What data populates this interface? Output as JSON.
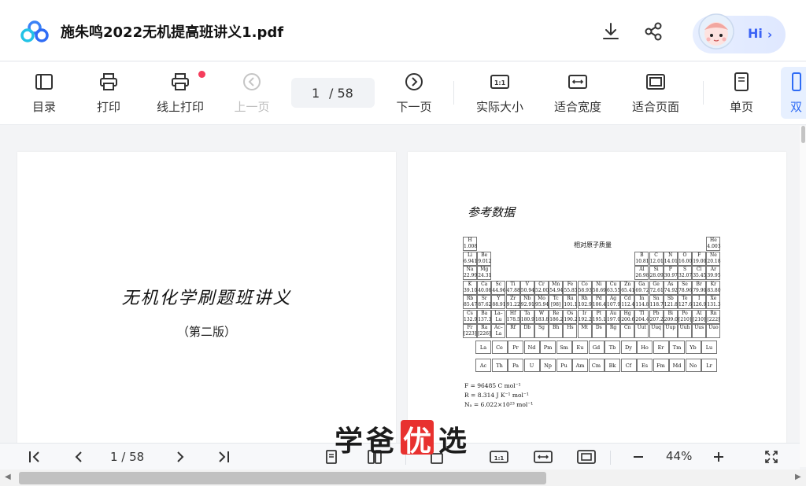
{
  "app": {
    "document_title": "施朱鸣2022无机提高班讲义1.pdf",
    "hi_label": "Hi"
  },
  "toolbar": {
    "toc_label": "目录",
    "print_label": "打印",
    "online_print_label": "线上打印",
    "prev_label": "上一页",
    "page_current": "1",
    "page_total": "/ 58",
    "next_label": "下一页",
    "actual_size_label": "实际大小",
    "fit_width_label": "适合宽度",
    "fit_page_label": "适合页面",
    "single_page_label": "单页",
    "double_page_label": "双"
  },
  "pages": {
    "cover_title": "无机化学刷题班讲义",
    "cover_subtitle": "（第二版）",
    "ref_title": "参考数据",
    "pt_caption": "相对原子质量",
    "elements": [
      {
        "s": "H",
        "m": "1.008",
        "r": 0,
        "c": 0
      },
      {
        "s": "He",
        "m": "4.003",
        "r": 0,
        "c": 17
      },
      {
        "s": "Li",
        "m": "6.941",
        "r": 1,
        "c": 0
      },
      {
        "s": "Be",
        "m": "9.012",
        "r": 1,
        "c": 1
      },
      {
        "s": "B",
        "m": "10.81",
        "r": 1,
        "c": 12
      },
      {
        "s": "C",
        "m": "12.01",
        "r": 1,
        "c": 13
      },
      {
        "s": "N",
        "m": "14.01",
        "r": 1,
        "c": 14
      },
      {
        "s": "O",
        "m": "16.00",
        "r": 1,
        "c": 15
      },
      {
        "s": "F",
        "m": "19.00",
        "r": 1,
        "c": 16
      },
      {
        "s": "Ne",
        "m": "20.18",
        "r": 1,
        "c": 17
      },
      {
        "s": "Na",
        "m": "22.99",
        "r": 2,
        "c": 0
      },
      {
        "s": "Mg",
        "m": "24.31",
        "r": 2,
        "c": 1
      },
      {
        "s": "Al",
        "m": "26.98",
        "r": 2,
        "c": 12
      },
      {
        "s": "Si",
        "m": "28.09",
        "r": 2,
        "c": 13
      },
      {
        "s": "P",
        "m": "30.97",
        "r": 2,
        "c": 14
      },
      {
        "s": "S",
        "m": "32.07",
        "r": 2,
        "c": 15
      },
      {
        "s": "Cl",
        "m": "35.45",
        "r": 2,
        "c": 16
      },
      {
        "s": "Ar",
        "m": "39.95",
        "r": 2,
        "c": 17
      },
      {
        "s": "K",
        "m": "39.10",
        "r": 3,
        "c": 0
      },
      {
        "s": "Ca",
        "m": "40.08",
        "r": 3,
        "c": 1
      },
      {
        "s": "Sc",
        "m": "44.96",
        "r": 3,
        "c": 2
      },
      {
        "s": "Ti",
        "m": "47.88",
        "r": 3,
        "c": 3
      },
      {
        "s": "V",
        "m": "50.94",
        "r": 3,
        "c": 4
      },
      {
        "s": "Cr",
        "m": "52.00",
        "r": 3,
        "c": 5
      },
      {
        "s": "Mn",
        "m": "54.94",
        "r": 3,
        "c": 6
      },
      {
        "s": "Fe",
        "m": "55.85",
        "r": 3,
        "c": 7
      },
      {
        "s": "Co",
        "m": "58.93",
        "r": 3,
        "c": 8
      },
      {
        "s": "Ni",
        "m": "58.69",
        "r": 3,
        "c": 9
      },
      {
        "s": "Cu",
        "m": "63.55",
        "r": 3,
        "c": 10
      },
      {
        "s": "Zn",
        "m": "65.41",
        "r": 3,
        "c": 11
      },
      {
        "s": "Ga",
        "m": "69.72",
        "r": 3,
        "c": 12
      },
      {
        "s": "Ge",
        "m": "72.61",
        "r": 3,
        "c": 13
      },
      {
        "s": "As",
        "m": "74.92",
        "r": 3,
        "c": 14
      },
      {
        "s": "Se",
        "m": "78.96",
        "r": 3,
        "c": 15
      },
      {
        "s": "Br",
        "m": "79.90",
        "r": 3,
        "c": 16
      },
      {
        "s": "Kr",
        "m": "83.80",
        "r": 3,
        "c": 17
      },
      {
        "s": "Rb",
        "m": "85.47",
        "r": 4,
        "c": 0
      },
      {
        "s": "Sr",
        "m": "87.62",
        "r": 4,
        "c": 1
      },
      {
        "s": "Y",
        "m": "88.91",
        "r": 4,
        "c": 2
      },
      {
        "s": "Zr",
        "m": "91.22",
        "r": 4,
        "c": 3
      },
      {
        "s": "Nb",
        "m": "92.91",
        "r": 4,
        "c": 4
      },
      {
        "s": "Mo",
        "m": "95.94",
        "r": 4,
        "c": 5
      },
      {
        "s": "Tc",
        "m": "[98]",
        "r": 4,
        "c": 6
      },
      {
        "s": "Ru",
        "m": "101.1",
        "r": 4,
        "c": 7
      },
      {
        "s": "Rh",
        "m": "102.9",
        "r": 4,
        "c": 8
      },
      {
        "s": "Pd",
        "m": "106.4",
        "r": 4,
        "c": 9
      },
      {
        "s": "Ag",
        "m": "107.9",
        "r": 4,
        "c": 10
      },
      {
        "s": "Cd",
        "m": "112.4",
        "r": 4,
        "c": 11
      },
      {
        "s": "In",
        "m": "114.8",
        "r": 4,
        "c": 12
      },
      {
        "s": "Sn",
        "m": "118.7",
        "r": 4,
        "c": 13
      },
      {
        "s": "Sb",
        "m": "121.8",
        "r": 4,
        "c": 14
      },
      {
        "s": "Te",
        "m": "127.6",
        "r": 4,
        "c": 15
      },
      {
        "s": "I",
        "m": "126.9",
        "r": 4,
        "c": 16
      },
      {
        "s": "Xe",
        "m": "131.3",
        "r": 4,
        "c": 17
      },
      {
        "s": "Cs",
        "m": "132.9",
        "r": 5,
        "c": 0
      },
      {
        "s": "Ba",
        "m": "137.3",
        "r": 5,
        "c": 1
      },
      {
        "s": "La–",
        "m": "Lu",
        "r": 5,
        "c": 2
      },
      {
        "s": "Hf",
        "m": "178.5",
        "r": 5,
        "c": 3
      },
      {
        "s": "Ta",
        "m": "180.9",
        "r": 5,
        "c": 4
      },
      {
        "s": "W",
        "m": "183.8",
        "r": 5,
        "c": 5
      },
      {
        "s": "Re",
        "m": "186.2",
        "r": 5,
        "c": 6
      },
      {
        "s": "Os",
        "m": "190.2",
        "r": 5,
        "c": 7
      },
      {
        "s": "Ir",
        "m": "192.2",
        "r": 5,
        "c": 8
      },
      {
        "s": "Pt",
        "m": "195.1",
        "r": 5,
        "c": 9
      },
      {
        "s": "Au",
        "m": "197.0",
        "r": 5,
        "c": 10
      },
      {
        "s": "Hg",
        "m": "200.6",
        "r": 5,
        "c": 11
      },
      {
        "s": "Tl",
        "m": "204.4",
        "r": 5,
        "c": 12
      },
      {
        "s": "Pb",
        "m": "207.2",
        "r": 5,
        "c": 13
      },
      {
        "s": "Bi",
        "m": "209.0",
        "r": 5,
        "c": 14
      },
      {
        "s": "Po",
        "m": "[210]",
        "r": 5,
        "c": 15
      },
      {
        "s": "At",
        "m": "[210]",
        "r": 5,
        "c": 16
      },
      {
        "s": "Rn",
        "m": "[222]",
        "r": 5,
        "c": 17
      },
      {
        "s": "Fr",
        "m": "[223]",
        "r": 6,
        "c": 0
      },
      {
        "s": "Ra",
        "m": "[226]",
        "r": 6,
        "c": 1
      },
      {
        "s": "Ac–",
        "m": "La",
        "r": 6,
        "c": 2
      },
      {
        "s": "Rf",
        "m": "",
        "r": 6,
        "c": 3
      },
      {
        "s": "Db",
        "m": "",
        "r": 6,
        "c": 4
      },
      {
        "s": "Sg",
        "m": "",
        "r": 6,
        "c": 5
      },
      {
        "s": "Bh",
        "m": "",
        "r": 6,
        "c": 6
      },
      {
        "s": "Hs",
        "m": "",
        "r": 6,
        "c": 7
      },
      {
        "s": "Mt",
        "m": "",
        "r": 6,
        "c": 8
      },
      {
        "s": "Ds",
        "m": "",
        "r": 6,
        "c": 9
      },
      {
        "s": "Rg",
        "m": "",
        "r": 6,
        "c": 10
      },
      {
        "s": "Cn",
        "m": "",
        "r": 6,
        "c": 11
      },
      {
        "s": "Uut",
        "m": "",
        "r": 6,
        "c": 12
      },
      {
        "s": "Uuq",
        "m": "",
        "r": 6,
        "c": 13
      },
      {
        "s": "Uup",
        "m": "",
        "r": 6,
        "c": 14
      },
      {
        "s": "Uuh",
        "m": "",
        "r": 6,
        "c": 15
      },
      {
        "s": "Uus",
        "m": "",
        "r": 6,
        "c": 16
      },
      {
        "s": "Uuo",
        "m": "",
        "r": 6,
        "c": 17
      }
    ],
    "lanthanides": [
      "La",
      "Ce",
      "Pr",
      "Nd",
      "Pm",
      "Sm",
      "Eu",
      "Gd",
      "Tb",
      "Dy",
      "Ho",
      "Er",
      "Tm",
      "Yb",
      "Lu"
    ],
    "actinides": [
      "Ac",
      "Th",
      "Pa",
      "U",
      "Np",
      "Pu",
      "Am",
      "Cm",
      "Bk",
      "Cf",
      "Es",
      "Fm",
      "Md",
      "No",
      "Lr"
    ],
    "constants": [
      "F = 96485 C mol⁻¹",
      "R = 8.314 J K⁻¹ mol⁻¹",
      "Nₐ = 6.022×10²³ mol⁻¹"
    ]
  },
  "bottombar": {
    "page_indicator": "1  / 58",
    "zoom": "44%"
  },
  "watermark": {
    "chars": [
      "学",
      "爸",
      "优",
      "选"
    ]
  },
  "colors": {
    "accent": "#3b63f5",
    "notification": "#f53d5c",
    "watermark_red": "#e8312f"
  }
}
